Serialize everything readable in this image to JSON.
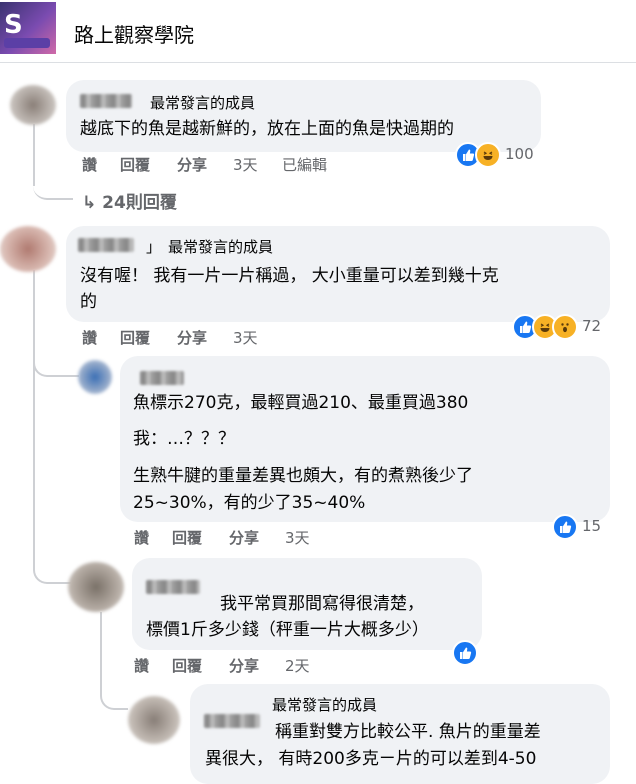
{
  "group": {
    "title": "路上觀察學院"
  },
  "comments": [
    {
      "badge": "最常發言的成員",
      "text": "越底下的魚是越新鮮的，放在上面的魚是快過期的",
      "actions": {
        "like": "讚",
        "reply": "回覆",
        "share": "分享",
        "time": "3天",
        "edited": "已編輯"
      },
      "reaction_count": "100"
    },
    {
      "badge": "最常發言的成員",
      "name_suffix": "」",
      "text_line1": "沒有喔！ 我有一片一片稱過， 大小重量可以差到幾十克",
      "text_line2": "的",
      "actions": {
        "like": "讚",
        "reply": "回覆",
        "share": "分享",
        "time": "3天"
      },
      "reaction_count": "72"
    }
  ],
  "more_replies": "24則回覆",
  "replies": [
    {
      "line1": "魚標示270克，最輕買過210、最重買過380",
      "line2": "我：…？？？",
      "line3": "生熟牛腱的重量差異也頗大，有的煮熟後少了",
      "line4": "25~30%，有的少了35~40%",
      "actions": {
        "like": "讚",
        "reply": "回覆",
        "share": "分享",
        "time": "3天"
      },
      "reaction_count": "15"
    },
    {
      "line1": "我平常買那間寫得很清楚，",
      "line2": "標價1斤多少錢（秤重一片大概多少）",
      "actions": {
        "like": "讚",
        "reply": "回覆",
        "share": "分享",
        "time": "2天"
      }
    },
    {
      "badge": "最常發言的成員",
      "line1": "稱重對雙方比較公平. 魚片的重量差",
      "line2": "異很大， 有時200多克ㄧ片的可以差到4-50"
    }
  ],
  "colors": {
    "like": "#1877f2",
    "reaction_yellow": "#f7b125",
    "bubble": "#f0f2f5",
    "meta": "#65676b"
  },
  "icons": [
    "thumbs-up-icon",
    "haha-icon",
    "wow-icon",
    "reply-arrow-icon"
  ]
}
